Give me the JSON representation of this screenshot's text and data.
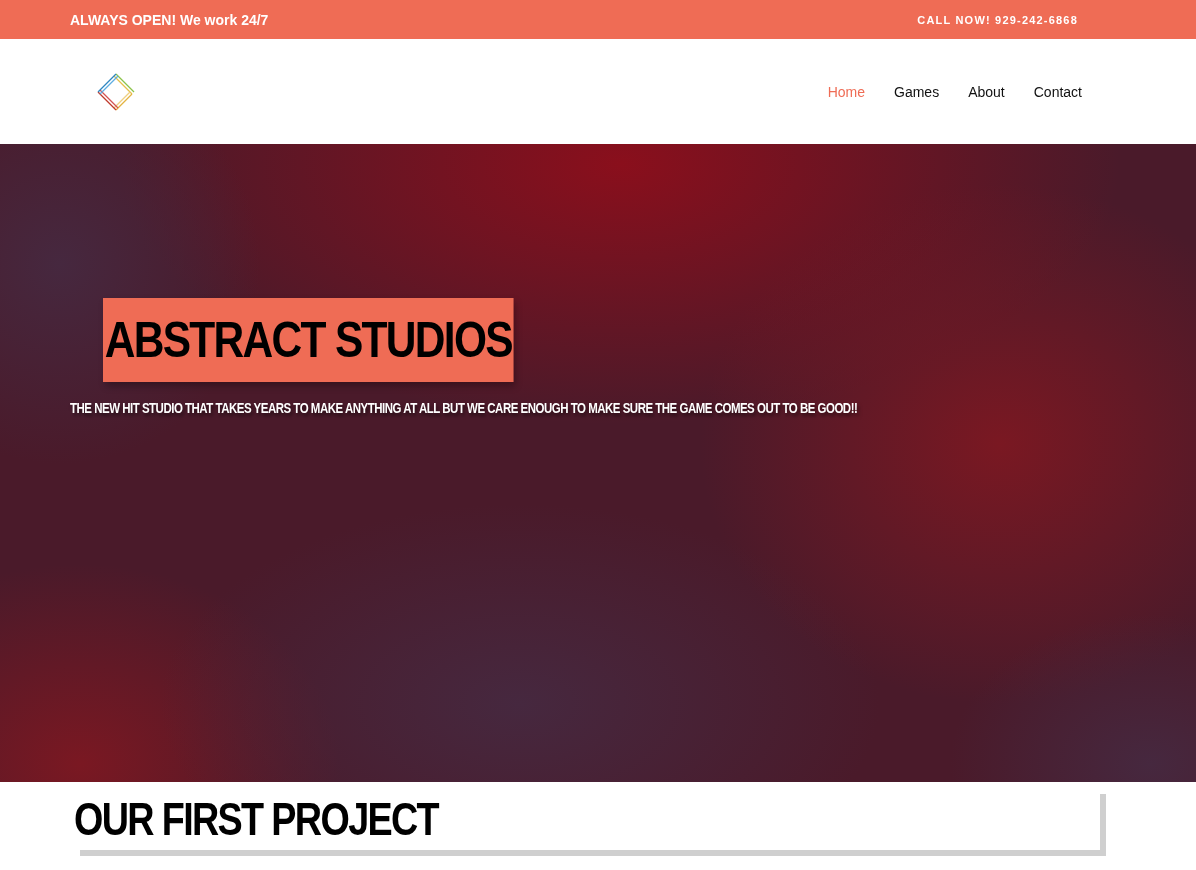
{
  "top_bar": {
    "left_text": "ALWAYS OPEN! We work 24/7",
    "right_text": "CALL NOW! 929-242-6868"
  },
  "nav": [
    {
      "label": "Home",
      "selected": true
    },
    {
      "label": "Games",
      "selected": false
    },
    {
      "label": "About",
      "selected": false
    },
    {
      "label": "Contact",
      "selected": false
    }
  ],
  "hero": {
    "kind": "picture",
    "title": "ABSTRACT STUDIOS",
    "subtitle": "THE NEW HIT STUDIO THAT TAKES YEARS TO MAKE ANYTHING AT ALL BUT WE CARE ENOUGH TO MAKE SURE THE GAME COMES OUT TO BE GOOD!!"
  },
  "section": {
    "heading": "OUR FIRST PROJECT"
  }
}
